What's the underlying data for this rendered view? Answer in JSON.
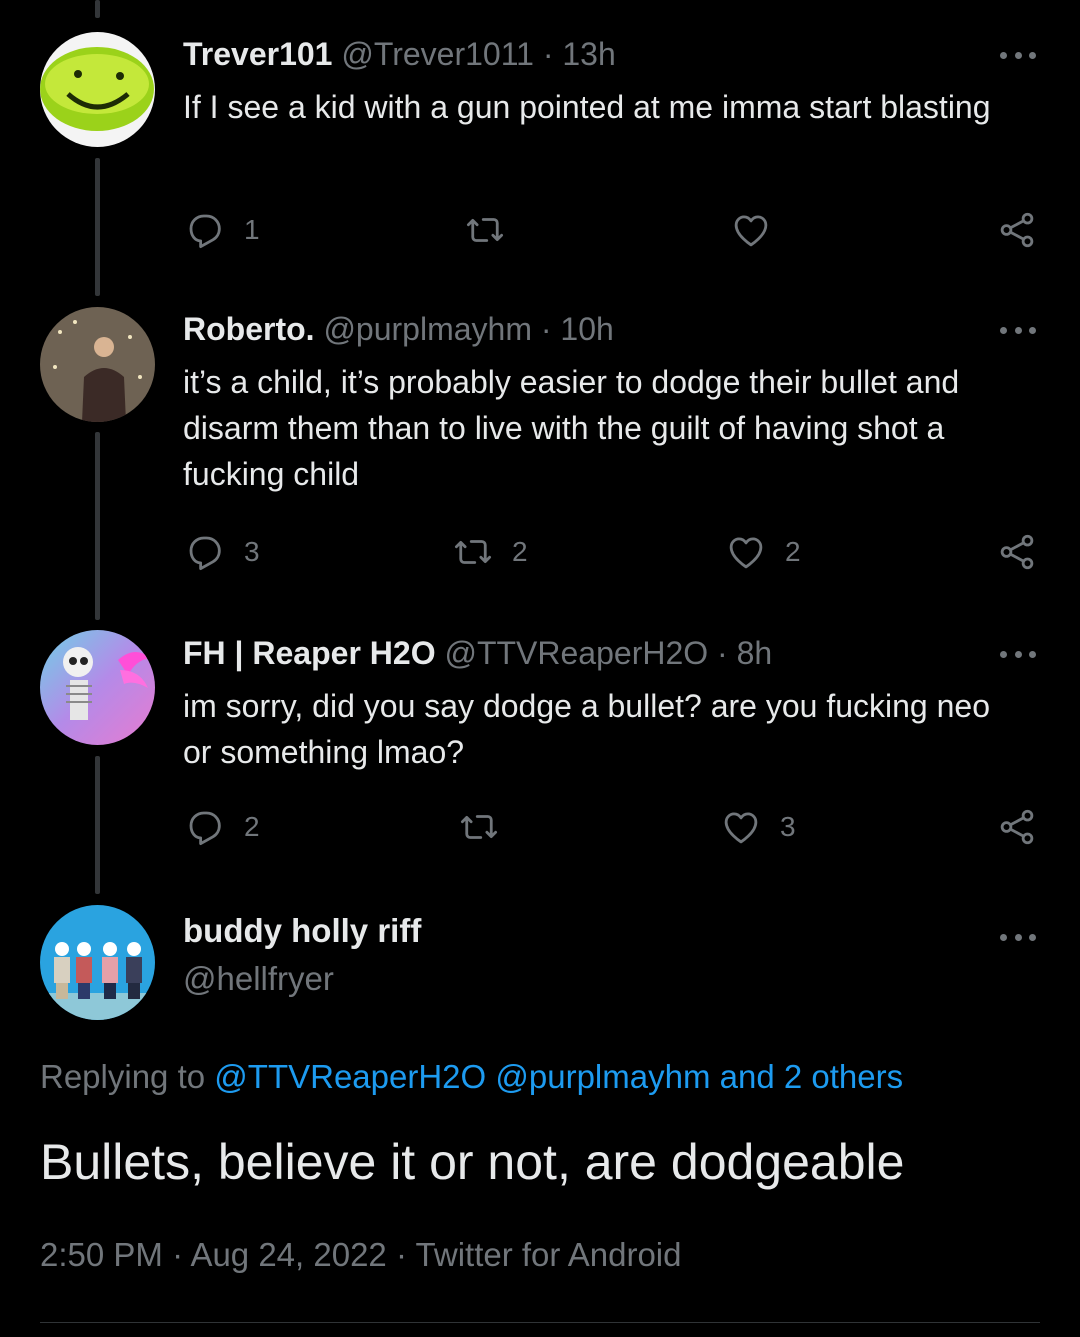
{
  "replies": [
    {
      "name": "Trever101",
      "handle": "@Trever1011",
      "separator": "·",
      "time": "13h",
      "text": "If I see a kid with a gun pointed at me imma start blasting",
      "reply_count": "1",
      "retweet_count": "",
      "like_count": ""
    },
    {
      "name": "Roberto.",
      "handle": "@purplmayhm",
      "separator": "·",
      "time": "10h",
      "text": "it’s a child, it’s probably easier to dodge their bullet and disarm them than to live with the guilt of having shot a fucking child",
      "reply_count": "3",
      "retweet_count": "2",
      "like_count": "2"
    },
    {
      "name": "FH | Reaper H2O",
      "handle": "@TTVReaperH2O",
      "separator": "·",
      "time": "8h",
      "text": "im sorry, did you say dodge a bullet?  are you fucking neo or something lmao?",
      "reply_count": "2",
      "retweet_count": "",
      "like_count": "3"
    }
  ],
  "main_tweet": {
    "name": "buddy holly riff",
    "handle": "@hellfryer",
    "replying_prefix": "Replying to",
    "replying_mention_1": "@TTVReaperH2O",
    "replying_mention_2": "@purplmayhm",
    "replying_others": "and 2 others",
    "text": "Bullets, believe it or not, are dodgeable",
    "time": "2:50 PM",
    "separator": "·",
    "date": "Aug 24, 2022",
    "source": "Twitter for Android"
  },
  "icons": {
    "reply": "reply-icon",
    "retweet": "retweet-icon",
    "like": "heart-icon",
    "share": "share-icon",
    "more": "more-icon"
  },
  "colors": {
    "background": "#000000",
    "text": "#e7e9ea",
    "muted": "#71767b",
    "link": "#1d9bf0"
  }
}
